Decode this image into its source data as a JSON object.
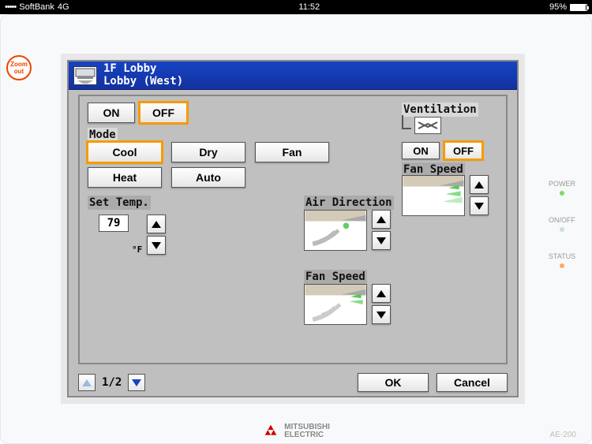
{
  "status": {
    "signal_dots": "•••••",
    "carrier": "SoftBank",
    "network": "4G",
    "time": "11:52",
    "battery_pct": "95%"
  },
  "bezel": {
    "zoom_out_label": "Zoom out",
    "power_label": "POWER",
    "onoff_label": "ON/OFF",
    "status_label": "STATUS",
    "brand": "MITSUBISHI",
    "brand2": "ELECTRIC",
    "model": "AE-200"
  },
  "title": {
    "line1": "1F Lobby",
    "line2": "Lobby (West)"
  },
  "main": {
    "on": "ON",
    "off": "OFF",
    "mode_label": "Mode",
    "modes": {
      "cool": "Cool",
      "dry": "Dry",
      "fan": "Fan",
      "heat": "Heat",
      "auto": "Auto"
    },
    "temp_label": "Set Temp.",
    "temp_value": "79",
    "temp_unit": "°F",
    "airdir_label": "Air Direction",
    "fanspeed_label": "Fan Speed"
  },
  "vent": {
    "label": "Ventilation",
    "on": "ON",
    "off": "OFF",
    "fanspeed_label": "Fan Speed"
  },
  "footer": {
    "page": "1/2",
    "ok": "OK",
    "cancel": "Cancel"
  }
}
